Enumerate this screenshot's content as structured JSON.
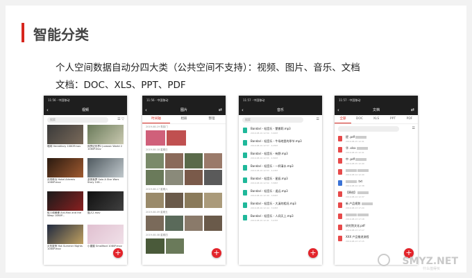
{
  "heading": "智能分类",
  "description": {
    "line1": "个人空间数据自动分四大类（公共空间不支持）：视频、图片、音乐、文档",
    "line2": "文档：DOC、XLS、PPT、PDF"
  },
  "colors": {
    "accent": "#d7261e",
    "fab": "#e3242b",
    "music_icon": "#1fb89a",
    "pdf_icon": "#e74a4a"
  },
  "phones": {
    "video": {
      "title": "视频",
      "status": "11:56 · 中国移动",
      "search_placeholder": "搜索",
      "items": [
        {
          "name": "暗网 Hereditary 1080P.mov"
        },
        {
          "name": "侏罗纪世界2 Jurassic World 2 1080P.mov"
        },
        {
          "name": "月球奇兵 Hotel Artemis 1080P.mov"
        },
        {
          "name": "游侠索罗 Solo A Star Wars Story 108..."
        },
        {
          "name": "蚁人和黄蜂 Ant-Man and the Wasp 1080P..."
        },
        {
          "name": "猫人2.mov"
        },
        {
          "name": "炎热夏夜 Hot Summer Nights 1080P.mov"
        },
        {
          "name": "小猩猩 Smallfoot 1080P.mov"
        }
      ]
    },
    "image": {
      "title": "图片",
      "status": "11:56 · 中国移动",
      "tabs": [
        "时间轴",
        "相册",
        "整理"
      ],
      "dates": [
        "2019.08.19 寿慕门",
        "2019.08.18 星期日",
        "2019.08.17 星期六",
        "2019.08.09 星期五",
        "2019.08.08 星期四"
      ]
    },
    "music": {
      "title": "音乐",
      "status": "11:57 · 中国移动",
      "search_placeholder": "搜索",
      "items": [
        {
          "name": "Bandari - 轻音乐 - 蒙娜莉.mp3",
          "meta": "2019.08.19 12:59 · 3.40M"
        },
        {
          "name": "Bandari - 轻音乐 - 牛场地里的季节.mp3",
          "meta": "2019.08.19 12:57 · 4.05M"
        },
        {
          "name": "Bandari - 轻音乐 - 有野.mp3",
          "meta": "2019.08.19 12:55 · 4.50M"
        },
        {
          "name": "Bandari - 轻音乐 - 一杯清水.mp3",
          "meta": "2019.08.19 12:53 · 4.03M"
        },
        {
          "name": "Bandari - 轻音乐 - 星辰.mp3",
          "meta": "2019.08.19 12:50 · 3.58M"
        },
        {
          "name": "Bandari - 轻音乐 - 遥远.mp3",
          "meta": "2019.08.19 12:49 · 3.84M"
        },
        {
          "name": "Bandari - 轻音乐 - 大溪的相况.mp3",
          "meta": "2019.08.19 12:44 · 3.93M"
        },
        {
          "name": "Bandari - 轻音乐 - 人间天上.mp3",
          "meta": "2019.08.19 12:41 · 3.47M"
        }
      ]
    },
    "docs": {
      "title": "文档",
      "status": "11:57 · 中国移动",
      "tabs": [
        "全部",
        "DOC",
        "XLS",
        "PPT",
        "PDF"
      ],
      "items": [
        {
          "name": "提 .pdf",
          "meta": "2019.08.15 12:41",
          "type": "pdf"
        },
        {
          "name": "华 .xlsx",
          "meta": "2019.08.15 12:41",
          "type": "pdf"
        },
        {
          "name": "中 .pdf",
          "meta": "2019.08.15 12:40",
          "type": "pdf"
        },
        {
          "name": "",
          "meta": "2019.08.14 12:40",
          "type": "pdf"
        },
        {
          "name": ".txt",
          "meta": "2019.08.14 12:38",
          "type": "word"
        },
        {
          "name": "【原创】",
          "meta": "2019.08.14 12:37",
          "type": "pdf"
        },
        {
          "name": "新 产品规划",
          "meta": "2019.08.13 17:20",
          "type": "pdf"
        },
        {
          "name": "",
          "meta": "2019.08.13 17:18",
          "type": "pdf"
        },
        {
          "name": "研究院文化.pdf",
          "meta": "2019.08.13 17:17",
          "type": "pdf"
        },
        {
          "name": "XXX 产品推进流程",
          "meta": "2019.08.13 17:15",
          "type": "pdf"
        }
      ]
    }
  },
  "watermark": {
    "text": "SMYZ.NET",
    "sub": "什么值得买"
  }
}
